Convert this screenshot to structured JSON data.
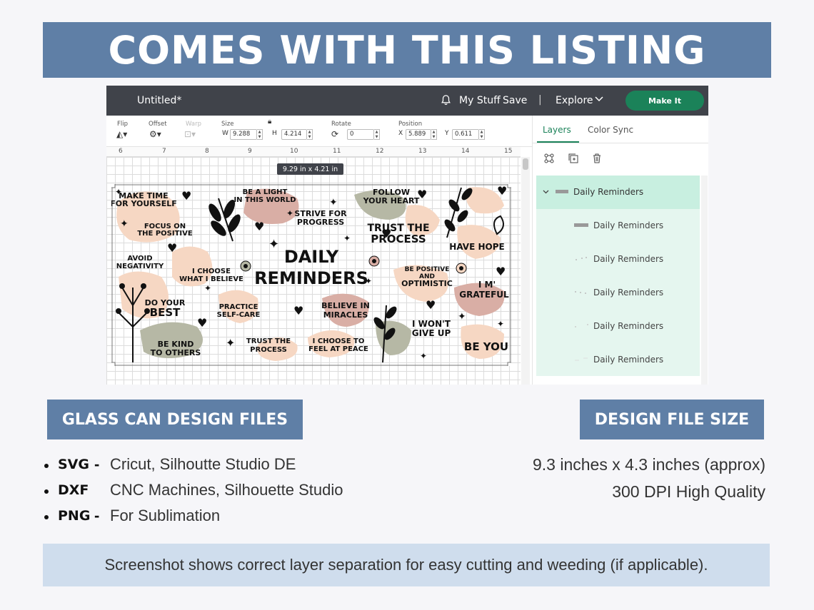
{
  "banner": {
    "title": "COMES WITH THIS LISTING"
  },
  "app": {
    "doc_title": "Untitled*",
    "nav": {
      "my_stuff": "My Stuff",
      "save": "Save",
      "separator": "|",
      "explore": "Explore",
      "make_it": "Make It"
    },
    "toolbar": {
      "flip": "Flip",
      "offset": "Offset",
      "warp": "Warp",
      "size": "Size",
      "w_label": "W",
      "w_value": "9.288",
      "h_label": "H",
      "h_value": "4.214",
      "rotate": "Rotate",
      "rotate_value": "0",
      "position": "Position",
      "x_label": "X",
      "x_value": "5.889",
      "y_label": "Y",
      "y_value": "0.611"
    },
    "ruler": [
      "6",
      "7",
      "8",
      "9",
      "10",
      "11",
      "12",
      "13",
      "14",
      "15"
    ],
    "selection_dims": "9.29  in x 4.21  in",
    "panel": {
      "tabs": [
        "Layers",
        "Color Sync"
      ],
      "group_name": "Daily Reminders",
      "layers": [
        "Daily Reminders",
        "Daily Reminders",
        "Daily Reminders",
        "Daily Reminders",
        "Daily Reminders"
      ]
    },
    "design_texts": {
      "t1": "MAKE TIME",
      "t2": "FOR YOURSELF",
      "t3": "FOCUS ON",
      "t4": "THE POSITIVE",
      "t5": "AVOID",
      "t6": "NEGATIVITY",
      "t7": "DO YOUR",
      "t8": "BEST",
      "t9": "BE KIND",
      "t10": "TO OTHERS",
      "t11": "BE A LIGHT",
      "t12": "IN THIS WORLD",
      "t13": "STRIVE FOR",
      "t14": "PROGRESS",
      "t15": "I CHOOSE",
      "t16": "WHAT I BELIEVE",
      "t17": "PRACTICE",
      "t18": "SELF-CARE",
      "t19": "TRUST THE",
      "t20": "PROCESS",
      "t21": "DAILY",
      "t22": "REMINDERS",
      "t23": "BELIEVE IN",
      "t24": "MIRACLES",
      "t25": "I CHOOSE TO",
      "t26": "FEEL AT PEACE",
      "t27": "FOLLOW",
      "t28": "YOUR HEART",
      "t29": "TRUST THE",
      "t30": "PROCESS",
      "t31": "BE POSITIVE",
      "t32": "AND",
      "t33": "OPTIMISTIC",
      "t34": "I WON'T",
      "t35": "GIVE UP",
      "t36": "HAVE HOPE",
      "t37": "I M'",
      "t38": "GRATEFUL",
      "t39": "BE YOU"
    }
  },
  "files_heading": "GLASS CAN DESIGN FILES",
  "size_heading": "DESIGN FILE SIZE",
  "formats": [
    {
      "format": "SVG",
      "dash": "-",
      "desc": "Cricut, Silhoutte Studio DE"
    },
    {
      "format": "DXF",
      "dash": "-",
      "desc": "CNC Machines, Silhouette Studio"
    },
    {
      "format": "PNG",
      "dash": "-",
      "desc": "For Sublimation"
    }
  ],
  "size": {
    "dimensions": "9.3 inches x 4.3 inches (approx)",
    "quality": "300 DPI High Quality"
  },
  "footer": "Screenshot shows correct layer separation for easy cutting and weeding (if applicable).",
  "colors": {
    "accent": "#5f7fa6",
    "footer_bg": "#cfdded",
    "make_it": "#1b8259",
    "topbar": "#40434a",
    "blob_peach": "#f6d7c3",
    "blob_rose": "#d9aea5",
    "blob_sage": "#b6b8a5"
  }
}
